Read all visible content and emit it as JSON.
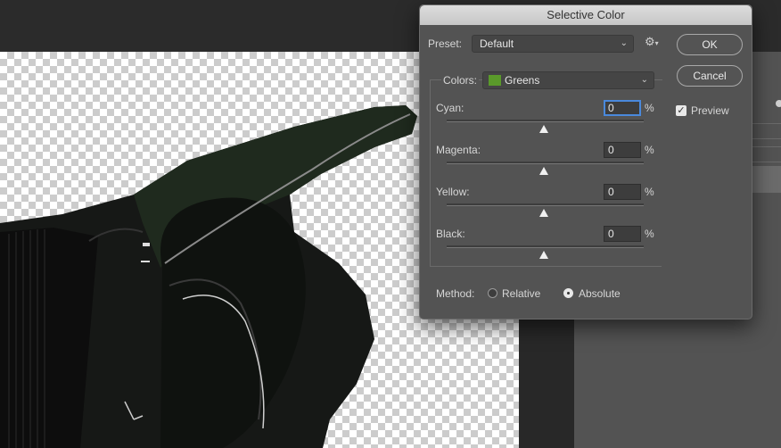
{
  "dialog": {
    "title": "Selective Color",
    "preset_label": "Preset:",
    "preset_value": "Default",
    "colors_label": "Colors:",
    "colors_value": "Greens",
    "colors_swatch": "#5a9a2a",
    "ok_label": "OK",
    "cancel_label": "Cancel",
    "preview_label": "Preview",
    "preview_checked": true,
    "sliders": [
      {
        "label": "Cyan:",
        "value": "0",
        "unit": "%"
      },
      {
        "label": "Magenta:",
        "value": "0",
        "unit": "%"
      },
      {
        "label": "Yellow:",
        "value": "0",
        "unit": "%"
      },
      {
        "label": "Black:",
        "value": "0",
        "unit": "%"
      }
    ],
    "method_label": "Method:",
    "method_options": [
      {
        "label": "Relative",
        "selected": false
      },
      {
        "label": "Absolute",
        "selected": true
      }
    ],
    "gear_icon": "gear-icon"
  },
  "colors": {
    "accent": "#4a89dc",
    "dialog_bg": "#535353"
  }
}
